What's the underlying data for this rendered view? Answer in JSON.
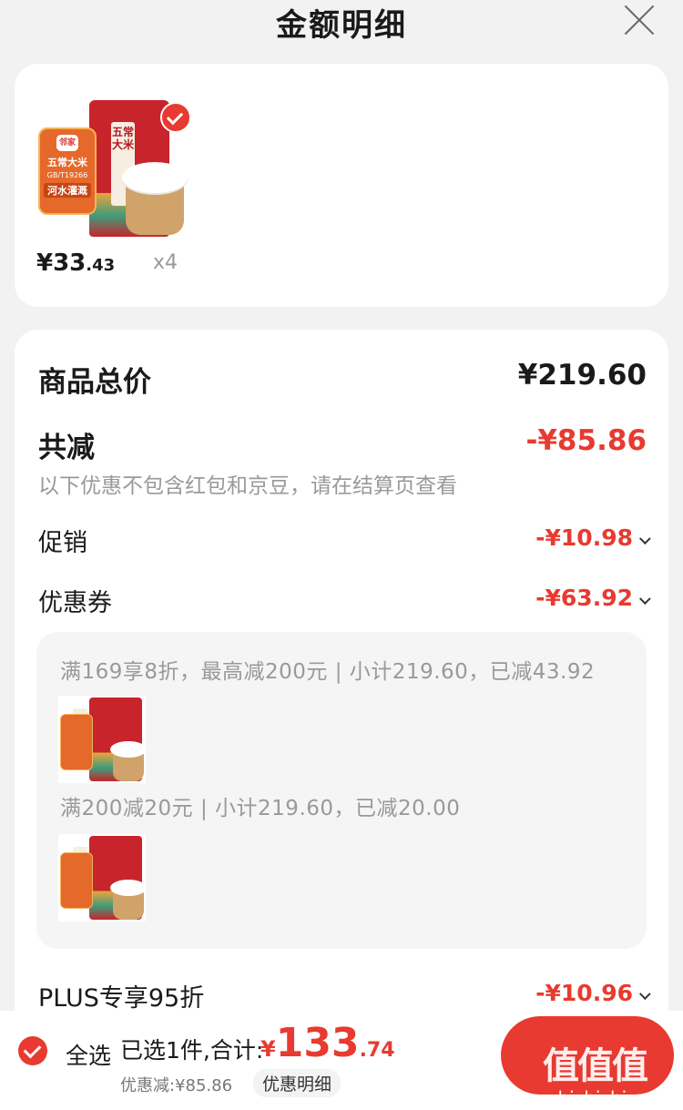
{
  "header": {
    "title": "金额明细"
  },
  "product": {
    "badge_lines": [
      "五常大米",
      "GB/T19266",
      "河水灌溉"
    ],
    "badge_logo": "邻家",
    "bag_text": "五常大米",
    "price_currency": "¥",
    "price_int": "33",
    "price_dec": ".43",
    "quantity": "x4"
  },
  "summary": {
    "total_label": "商品总价",
    "total_value": "¥219.60",
    "reduce_label": "共减",
    "reduce_value": "-¥85.86",
    "note": "以下优惠不包含红包和京豆，请在结算页查看",
    "promo_label": "促销",
    "promo_value": "-¥10.98",
    "coupon_label": "优惠券",
    "coupon_value": "-¥63.92",
    "coupon_details": [
      "满169享8折，最高减200元 | 小计219.60，已减43.92",
      "满200减20元 | 小计219.60，已减20.00"
    ],
    "plus_label": "PLUS专享95折",
    "plus_value": "-¥10.96"
  },
  "bottom": {
    "select_all": "全选",
    "selected_text": "已选1件,合计:",
    "total_currency": "¥",
    "total_int": "133",
    "total_dec": ".74",
    "discount_text": "优惠减:¥85.86",
    "detail_link": "优惠明细",
    "watermark": "值值值",
    "watermark_url": "zhizhizhi.com"
  },
  "colors": {
    "accent": "#e83a30",
    "background": "#f2f2f2"
  },
  "icons": [
    "close-icon",
    "check-icon",
    "chevron-down-icon"
  ]
}
